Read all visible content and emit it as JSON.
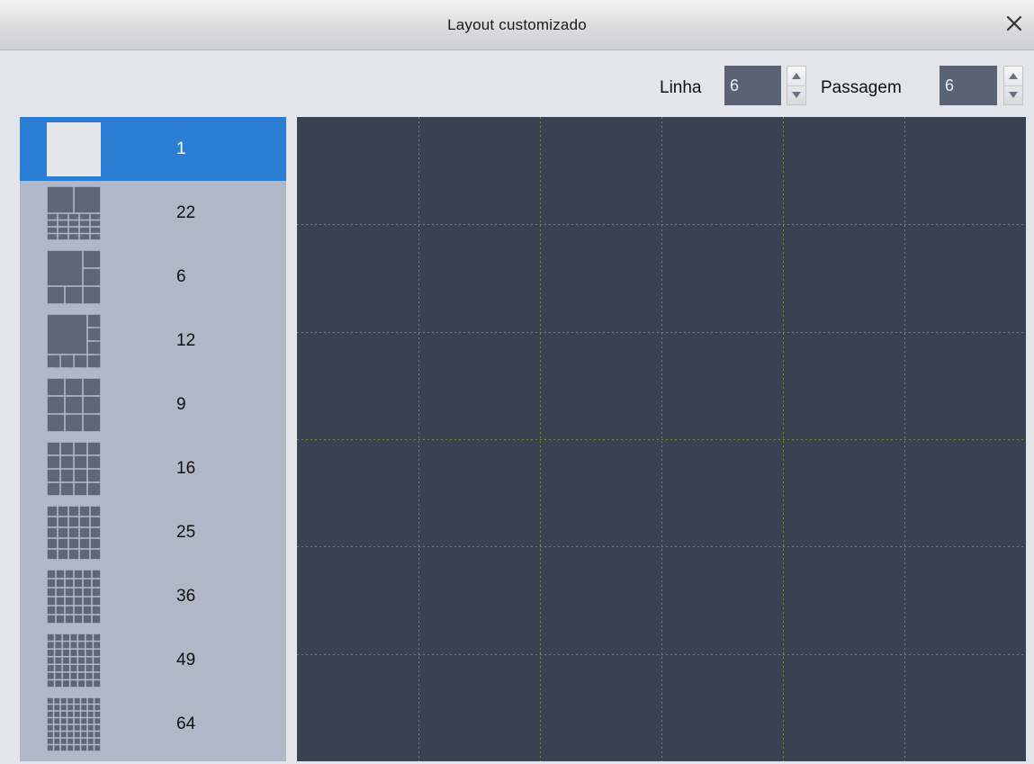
{
  "window": {
    "title": "Layout customizado",
    "close_icon": "close-icon"
  },
  "controls": {
    "rows": {
      "label": "Linha",
      "value": "6"
    },
    "columns": {
      "label": "Passagem",
      "value": "6"
    }
  },
  "layouts": [
    {
      "count": "1",
      "selected": true,
      "icon": "layout-1-icon"
    },
    {
      "count": "22",
      "selected": false,
      "icon": "layout-22-icon"
    },
    {
      "count": "6",
      "selected": false,
      "icon": "layout-6-icon"
    },
    {
      "count": "12",
      "selected": false,
      "icon": "layout-12-icon"
    },
    {
      "count": "9",
      "selected": false,
      "icon": "layout-9-icon"
    },
    {
      "count": "16",
      "selected": false,
      "icon": "layout-16-icon"
    },
    {
      "count": "25",
      "selected": false,
      "icon": "layout-25-icon"
    },
    {
      "count": "36",
      "selected": false,
      "icon": "layout-36-icon"
    },
    {
      "count": "49",
      "selected": false,
      "icon": "layout-49-icon"
    },
    {
      "count": "64",
      "selected": false,
      "icon": "layout-64-icon"
    }
  ],
  "grid": {
    "rows": 6,
    "columns": 6
  },
  "colors": {
    "selected": "#2a7fd4",
    "sidebar": "#b0b7c6",
    "grid_bg": "#3a4150",
    "grid_line": "#7a8a3a",
    "thumb_tile": "#5e6677",
    "thumb_selected": "#e4e6ea"
  }
}
